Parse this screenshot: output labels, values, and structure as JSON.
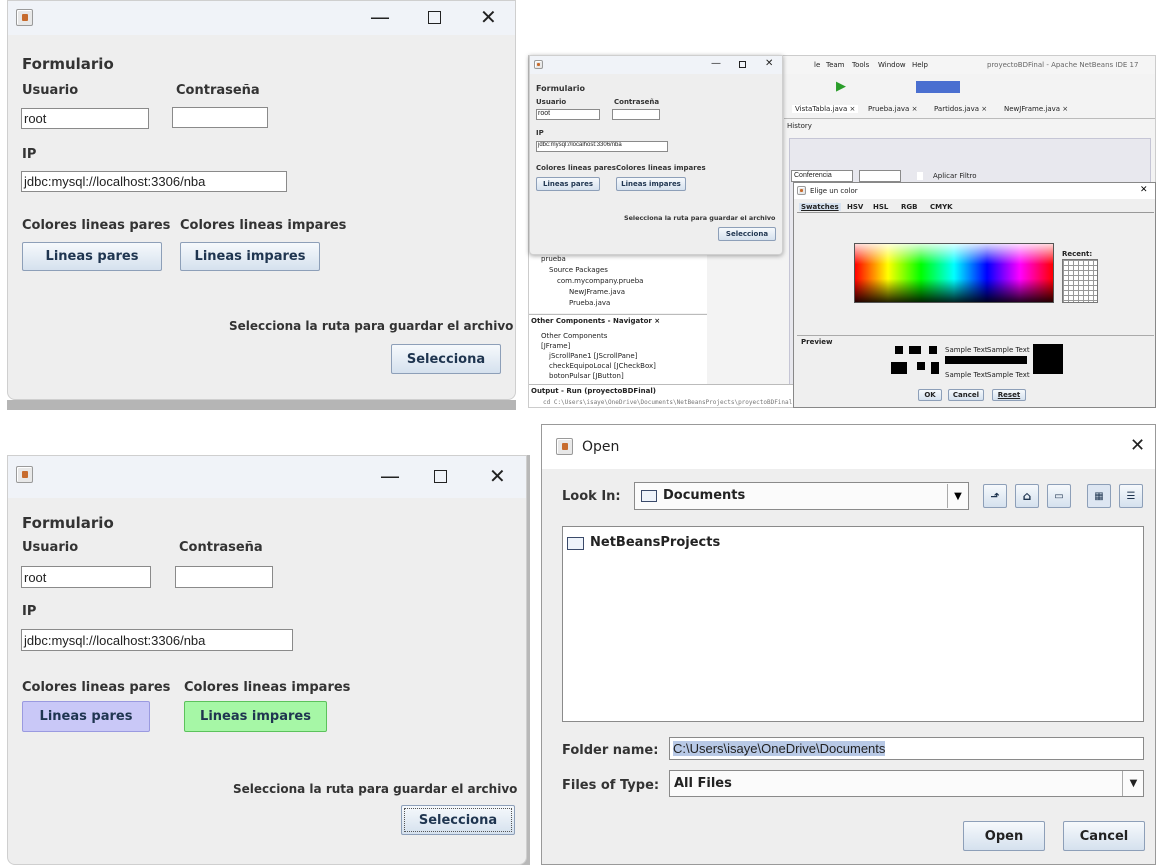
{
  "form": {
    "title": "Formulario",
    "user_label": "Usuario",
    "user_value": "root",
    "password_label": "Contraseña",
    "ip_label": "IP",
    "ip_value": "jdbc:mysql://localhost:3306/nba",
    "even_label": "Colores lineas pares",
    "odd_label": "Colores lineas impares",
    "even_button": "Lineas pares",
    "odd_button": "Lineas impares",
    "path_label": "Selecciona la ruta para guardar el archivo",
    "select_button": "Selecciona"
  },
  "colors_applied": {
    "even": "#c9c8f7",
    "odd": "#a6f7a6"
  },
  "ide": {
    "menu": [
      "le",
      "Team",
      "Tools",
      "Window",
      "Help"
    ],
    "title": "proyectoBDFinal - Apache NetBeans IDE 17",
    "tabs": [
      "VistaTabla.java ×",
      "Prueba.java ×",
      "Partidos.java ×",
      "NewJFrame.java ×"
    ],
    "history": "History",
    "conferencia": "Conferencia",
    "aplicar_filtro": "Aplicar Filtro",
    "project_tree": [
      "prueba",
      "Source Packages",
      "com.mycompany.prueba",
      "NewJFrame.java",
      "Prueba.java"
    ],
    "navigator_title": "Other Components - Navigator ×",
    "navigator_items": [
      "Other Components",
      "[JFrame]",
      "jScrollPane1 [JScrollPane]",
      "checkEquipoLocal [JCheckBox]",
      "botonPulsar [JButton]"
    ],
    "output_title": "Output - Run (proyectoBDFinal)",
    "output_line": "cd C:\\Users\\isaye\\OneDrive\\Documents\\NetBeansProjects\\proyectoBDFinal; JAVA_HOME=C:\\Program Files\\Java\\jdk-17 mvn"
  },
  "color_chooser": {
    "title": "Elige un color",
    "tabs": [
      "Swatches",
      "HSV",
      "HSL",
      "RGB",
      "CMYK"
    ],
    "recent": "Recent:",
    "preview": "Preview",
    "sample": "Sample Text",
    "ok": "OK",
    "cancel": "Cancel",
    "reset": "Reset"
  },
  "open_dialog": {
    "title": "Open",
    "look_in_label": "Look In:",
    "look_in_value": "Documents",
    "folder_item": "NetBeansProjects",
    "folder_name_label": "Folder name:",
    "folder_name_value": "C:\\Users\\isaye\\OneDrive\\Documents",
    "files_type_label": "Files of Type:",
    "files_type_value": "All Files",
    "open": "Open",
    "cancel": "Cancel"
  },
  "icons": [
    "java-app-icon",
    "minimize-icon",
    "maximize-icon",
    "close-icon",
    "folder-icon",
    "up-folder-icon",
    "home-icon",
    "new-folder-icon",
    "list-view-icon",
    "details-view-icon",
    "dropdown-arrow-icon"
  ]
}
